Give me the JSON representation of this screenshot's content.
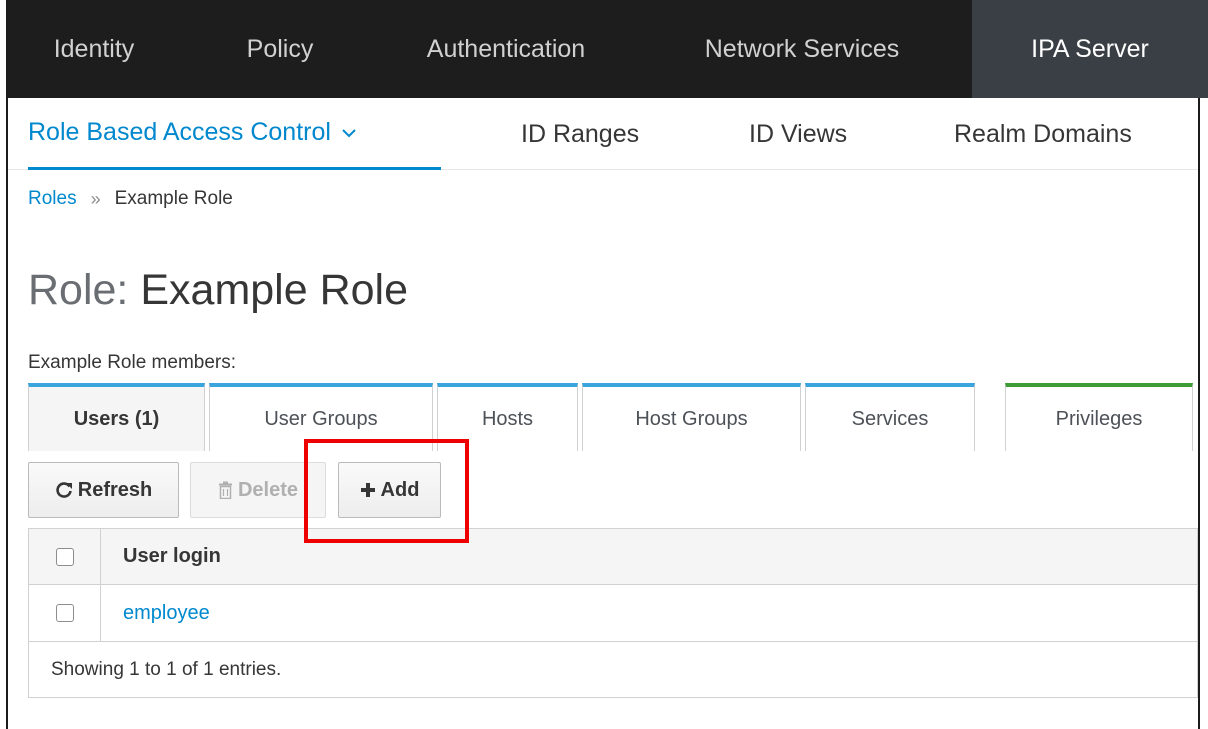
{
  "topnav": {
    "items": [
      {
        "label": "Identity"
      },
      {
        "label": "Policy"
      },
      {
        "label": "Authentication"
      },
      {
        "label": "Network Services"
      },
      {
        "label": "IPA Server"
      }
    ]
  },
  "subnav": {
    "items": [
      {
        "label": "Role Based Access Control"
      },
      {
        "label": "ID Ranges"
      },
      {
        "label": "ID Views"
      },
      {
        "label": "Realm Domains"
      }
    ]
  },
  "breadcrumb": {
    "parent": "Roles",
    "separator": "»",
    "current": "Example Role"
  },
  "page": {
    "title_prefix": "Role: ",
    "title_name": "Example Role",
    "members_label": "Example Role members:"
  },
  "tabs": [
    {
      "label": "Users (1)"
    },
    {
      "label": "User Groups"
    },
    {
      "label": "Hosts"
    },
    {
      "label": "Host Groups"
    },
    {
      "label": "Services"
    },
    {
      "label": "Privileges"
    }
  ],
  "toolbar": {
    "refresh_label": "Refresh",
    "delete_label": "Delete",
    "add_label": "Add"
  },
  "table": {
    "columns": [
      "User login"
    ],
    "rows": [
      {
        "user_login": "employee"
      }
    ],
    "footer": "Showing 1 to 1 of 1 entries."
  },
  "colors": {
    "accent": "#0088ce",
    "tab_top_blue": "#39a5dc",
    "tab_top_green": "#3f9c35",
    "highlight": "#ee0000",
    "nav_bg": "#1d1d1d"
  }
}
